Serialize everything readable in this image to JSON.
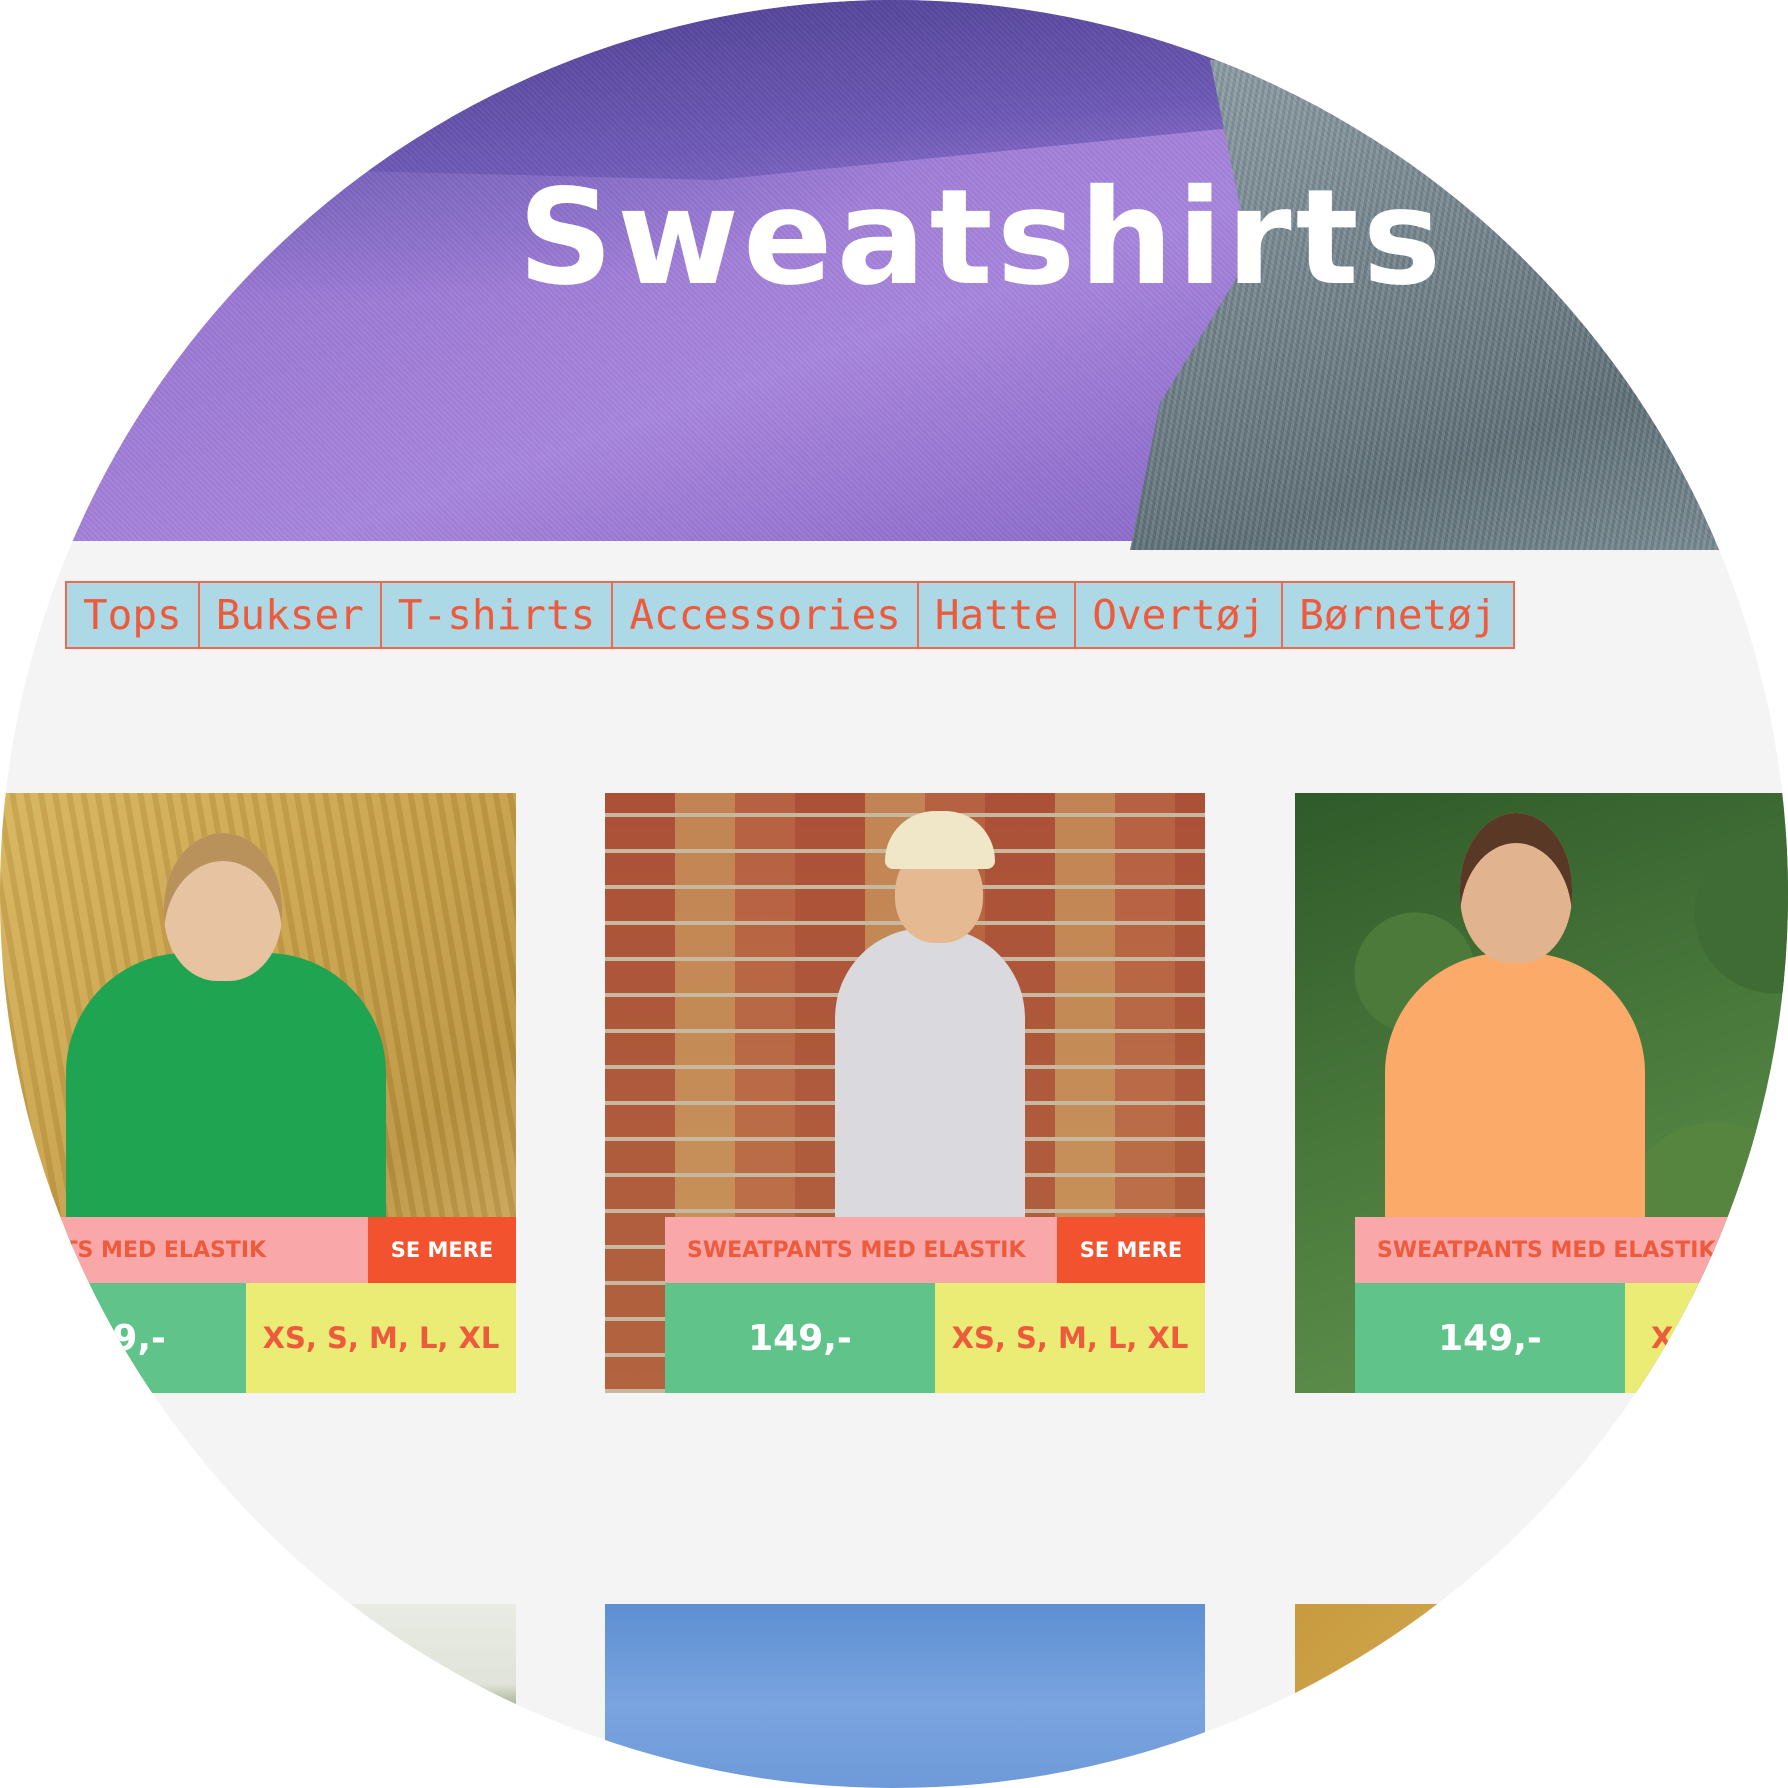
{
  "hero": {
    "title": "Sweatshirts"
  },
  "nav": {
    "items": [
      {
        "label": "Tops"
      },
      {
        "label": "Bukser"
      },
      {
        "label": "T-shirts"
      },
      {
        "label": "Accessories"
      },
      {
        "label": "Hatte"
      },
      {
        "label": "Overtøj"
      },
      {
        "label": "Børnetøj"
      }
    ]
  },
  "products": [
    {
      "name": "TPANTS MED ELASTIK",
      "cta": "SE MERE",
      "price": "9,-",
      "sizes": "XS, S, M, L, XL"
    },
    {
      "name": "SWEATPANTS MED ELASTIK",
      "cta": "SE MERE",
      "price": "149,-",
      "sizes": "XS, S, M, L, XL"
    },
    {
      "name": "SWEATPANTS MED ELASTIK",
      "cta": "",
      "price": "149,-",
      "sizes": "X"
    }
  ],
  "colors": {
    "nav_bg": "#add8e6",
    "nav_text": "#ee5a3c",
    "name_bg": "#f9a7a8",
    "cta_bg": "#f2522d",
    "price_bg": "#60c38a",
    "sizes_bg": "#eaec76"
  }
}
